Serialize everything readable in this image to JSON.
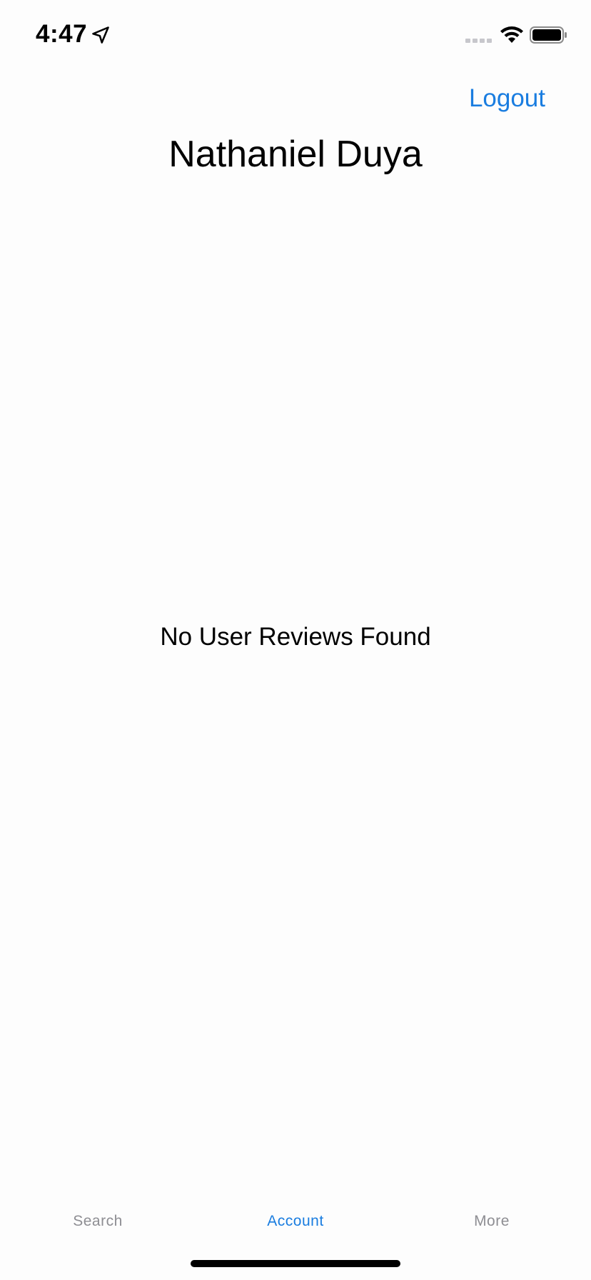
{
  "status_bar": {
    "time": "4:47",
    "icons": [
      "location-arrow-icon",
      "cellular-signal-icon",
      "wifi-icon",
      "battery-icon"
    ]
  },
  "header": {
    "logout_label": "Logout",
    "title": "Nathaniel Duya"
  },
  "main": {
    "empty_message": "No User Reviews Found"
  },
  "tab_bar": {
    "tabs": [
      {
        "label": "Search",
        "active": false
      },
      {
        "label": "Account",
        "active": true
      },
      {
        "label": "More",
        "active": false
      }
    ]
  },
  "colors": {
    "accent": "#1a7de0",
    "inactive_tab": "#8e8e93",
    "text": "#000000",
    "background": "#fdfdfd"
  }
}
